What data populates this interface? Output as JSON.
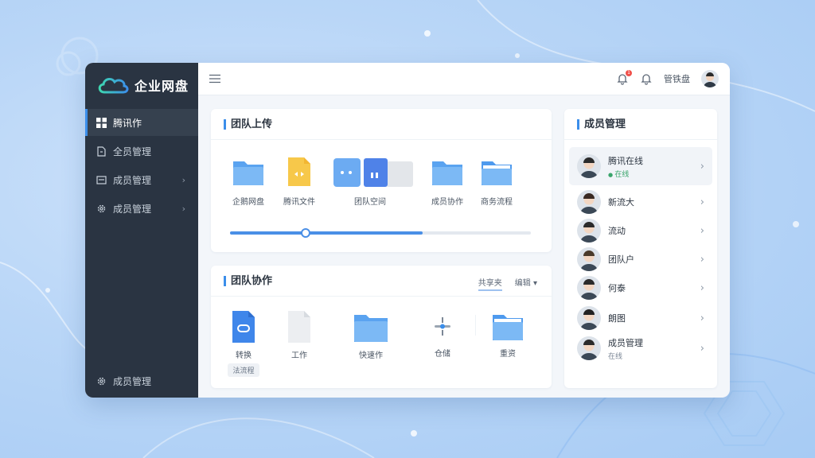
{
  "brand": {
    "name": "企业网盘"
  },
  "sidebar": {
    "items": [
      {
        "label": "腾讯作",
        "icon": "grid-icon",
        "active": true,
        "arrow": false
      },
      {
        "label": "全员管理",
        "icon": "file-icon",
        "active": false,
        "arrow": false
      },
      {
        "label": "成员管理",
        "icon": "folder-icon",
        "active": false,
        "arrow": true
      },
      {
        "label": "成员管理",
        "icon": "gear-icon",
        "active": false,
        "arrow": true
      }
    ],
    "footer_label": "成员管理",
    "arrow_glyph": "›"
  },
  "topbar": {
    "badge_count": "1",
    "user_name": "管铁盘"
  },
  "upload": {
    "title": "团队上传",
    "files": [
      {
        "label": "企鹅网盘",
        "type": "folder"
      },
      {
        "label": "腾讯文件",
        "type": "doc-yellow"
      },
      {
        "label": "团队空间",
        "type": "stack"
      },
      {
        "label": "成员协作",
        "type": "folder"
      },
      {
        "label": "商务流程",
        "type": "folder-open"
      }
    ],
    "progress": 0.64,
    "knob": 0.25
  },
  "collab": {
    "title": "团队协作",
    "tabs": [
      "共享夹",
      "编辑"
    ],
    "files": [
      {
        "label": "转换",
        "type": "doc-blue",
        "chip": "法流程"
      },
      {
        "label": "工作",
        "type": "doc-gray"
      },
      {
        "label": "快速作",
        "type": "folder"
      },
      {
        "label": "仓储",
        "type": "tools"
      },
      {
        "label": "重资",
        "type": "folder-open"
      }
    ]
  },
  "members": {
    "title": "成员管理",
    "list": [
      {
        "name": "腾讯在线",
        "sub": "在线",
        "online": true
      },
      {
        "name": "新流大",
        "sub": ""
      },
      {
        "name": "流动",
        "sub": ""
      },
      {
        "name": "团队户",
        "sub": ""
      },
      {
        "name": "何泰",
        "sub": ""
      },
      {
        "name": "朗图",
        "sub": ""
      },
      {
        "name": "成员管理",
        "sub": "在线"
      }
    ]
  },
  "colors": {
    "accent": "#3b8eea",
    "sidebar": "#2a3442",
    "folder": "#5aa3f0"
  }
}
